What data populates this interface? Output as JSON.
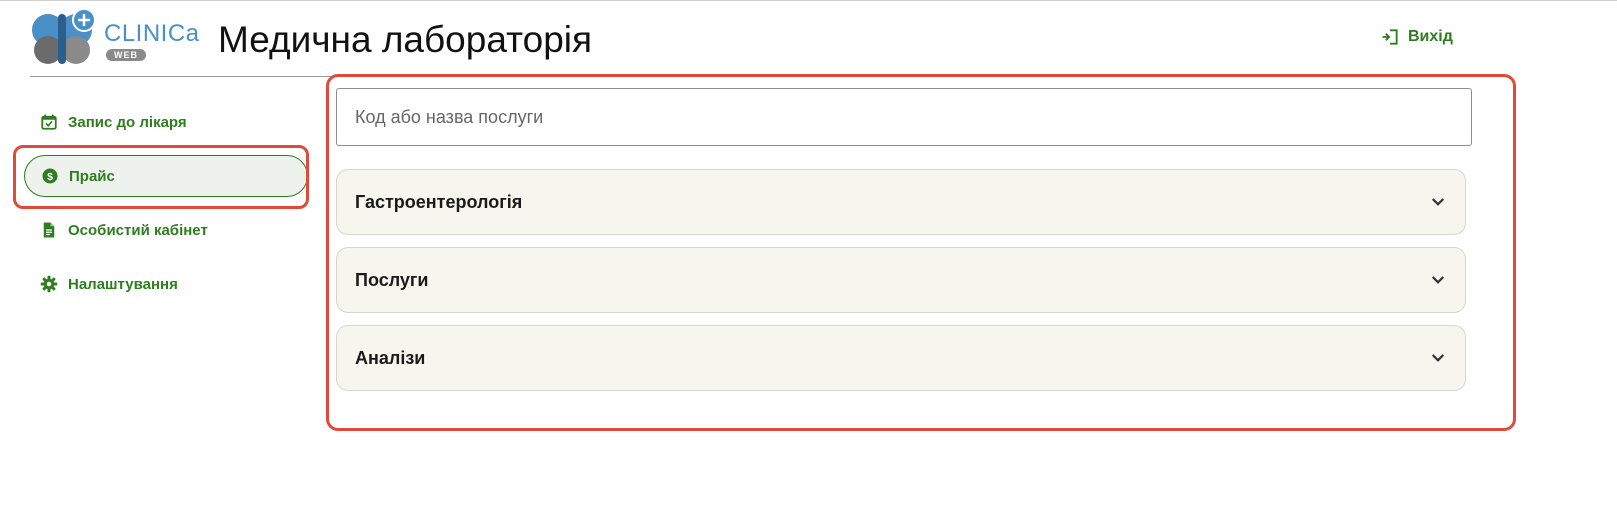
{
  "header": {
    "logo_text": "CLINICa",
    "logo_sub": "WEB",
    "title": "Медична лабораторія",
    "logout_label": "Вихід"
  },
  "sidebar": {
    "items": [
      {
        "label": "Запис до лікаря",
        "icon": "calendar-check-icon",
        "active": false
      },
      {
        "label": "Прайс",
        "icon": "dollar-circle-icon",
        "active": true
      },
      {
        "label": "Особистий кабінет",
        "icon": "document-icon",
        "active": false
      },
      {
        "label": "Налаштування",
        "icon": "gear-icon",
        "active": false
      }
    ]
  },
  "main": {
    "search_placeholder": "Код або назва послуги",
    "sections": [
      {
        "label": "Гастроентерологія",
        "expanded": false
      },
      {
        "label": "Послуги",
        "expanded": false
      },
      {
        "label": "Аналізи",
        "expanded": false
      }
    ]
  },
  "colors": {
    "accent": "#2e7d1e",
    "highlight": "#e04a3a",
    "accordion_bg": "#f6f6ef",
    "logo_blue": "#4a90c8"
  }
}
